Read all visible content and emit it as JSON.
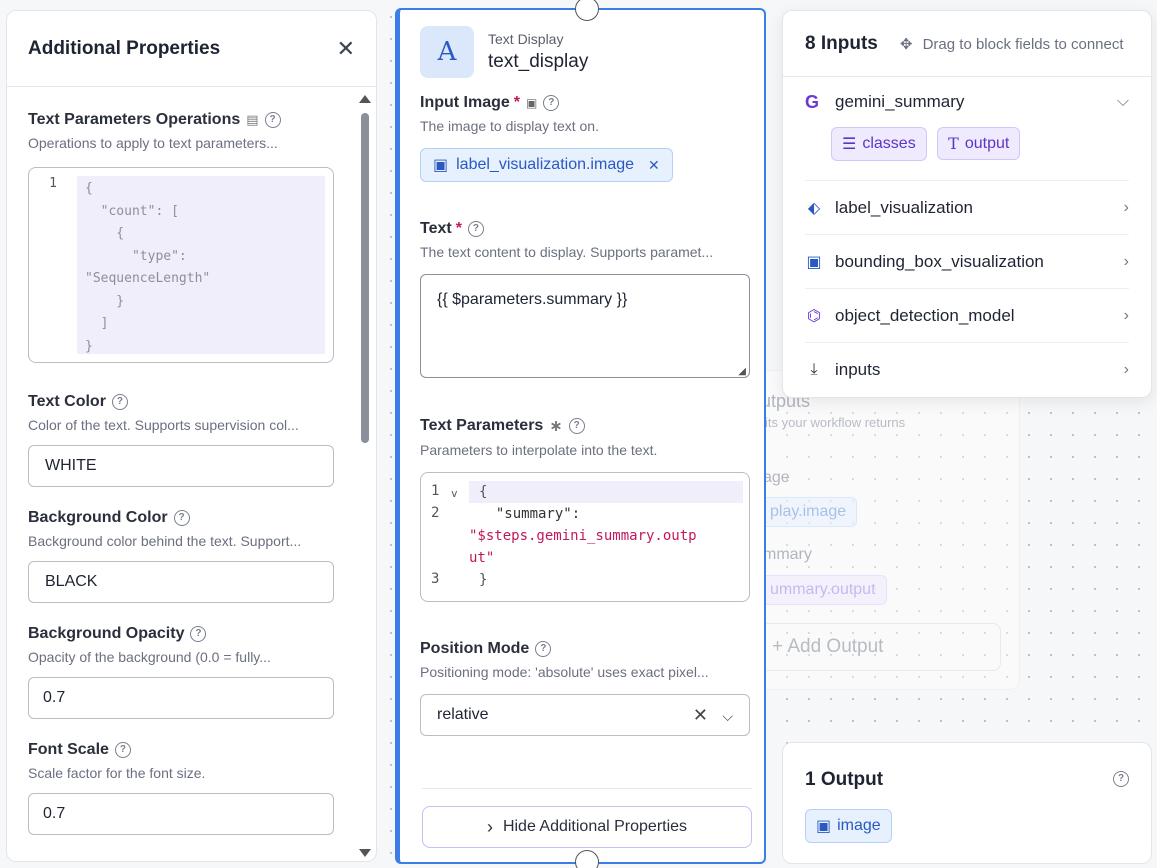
{
  "left": {
    "title": "Additional Properties",
    "fields": [
      {
        "label": "Text Parameters Operations",
        "desc": "Operations to apply to text parameters..."
      },
      {
        "label": "Text Color",
        "desc": "Color of the text. Supports supervision col...",
        "value": "WHITE"
      },
      {
        "label": "Background Color",
        "desc": "Background color behind the text. Support...",
        "value": "BLACK"
      },
      {
        "label": "Background Opacity",
        "desc": "Opacity of the background (0.0 = fully...",
        "value": "0.7"
      },
      {
        "label": "Font Scale",
        "desc": "Scale factor for the font size.",
        "value": "0.7"
      }
    ],
    "ops_code": "{\n  \"count\": [\n    {\n      \"type\":\n\"SequenceLength\"\n    }\n  ]\n}",
    "ops_line": "1"
  },
  "block": {
    "type": "Text Display",
    "name": "text_display",
    "icon_letter": "A",
    "input_image": {
      "label": "Input Image",
      "required": "*",
      "desc": "The image to display text on.",
      "chip": "label_visualization.image"
    },
    "text": {
      "label": "Text",
      "required": "*",
      "desc": "The text content to display. Supports paramet...",
      "value": "{{ $parameters.summary }}"
    },
    "text_params": {
      "label": "Text Parameters",
      "desc": "Parameters to interpolate into the text.",
      "lines": [
        "1",
        "2",
        "3"
      ],
      "code_l1": "{",
      "code_l2a": "  \"summary\":",
      "code_l2b": "\"$steps.gemini_summary.outp",
      "code_l2c": "ut\"",
      "code_l3": "}"
    },
    "position_mode": {
      "label": "Position Mode",
      "desc": "Positioning mode: 'absolute' uses exact pixel...",
      "value": "relative"
    },
    "hide_button": "Hide Additional Properties"
  },
  "inputs_panel": {
    "title": "8 Inputs",
    "hint": "Drag to block fields to connect",
    "items": [
      {
        "name": "gemini_summary",
        "icon": "gemini-icon",
        "expanded": true,
        "chips": [
          "classes",
          "output"
        ]
      },
      {
        "name": "label_visualization",
        "icon": "tag-icon"
      },
      {
        "name": "bounding_box_visualization",
        "icon": "bbox-icon"
      },
      {
        "name": "object_detection_model",
        "icon": "model-icon"
      },
      {
        "name": "inputs",
        "icon": "download-icon"
      }
    ]
  },
  "outputs_bg": {
    "title": "utputs",
    "subtitle": "its your workflow returns",
    "row1": "age",
    "chip1": "play.image",
    "row2": "mmary",
    "chip2": "ummary.output",
    "add": "+ Add Output"
  },
  "output_panel": {
    "title": "1 Output",
    "chip": "image"
  },
  "colors": {
    "accent": "#3b7ee8",
    "purple": "#5b35c9",
    "required": "#c2185b"
  }
}
